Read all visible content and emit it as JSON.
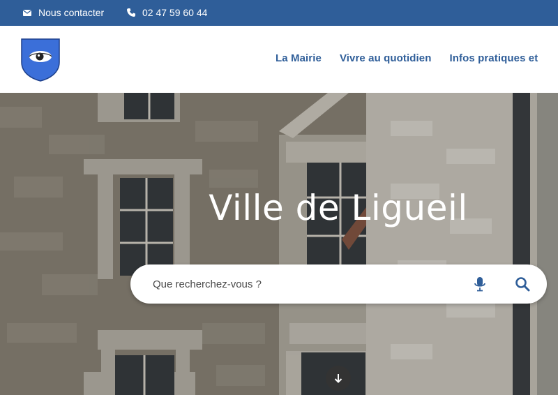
{
  "topbar": {
    "contact_label": "Nous contacter",
    "phone_label": "02 47 59 60 44",
    "contact_icon": "envelope-icon",
    "phone_icon": "phone-icon"
  },
  "header": {
    "logo_icon": "coat-of-arms-icon",
    "nav": [
      {
        "label": "La Mairie"
      },
      {
        "label": "Vivre au quotidien"
      },
      {
        "label": "Infos pratiques et"
      }
    ]
  },
  "hero": {
    "title": "Ville de Ligueil",
    "search": {
      "placeholder": "Que recherchez-vous ?",
      "value": "",
      "mic_icon": "microphone-icon",
      "search_icon": "search-icon"
    },
    "scroll_icon": "arrow-down-icon"
  },
  "colors": {
    "brand_blue": "#2f5e99",
    "topbar_bg": "#2f5e99",
    "nav_text": "#2f5e99"
  }
}
